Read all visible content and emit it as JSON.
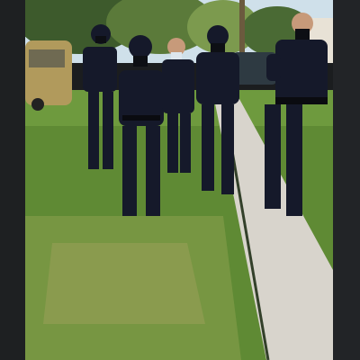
{
  "image": {
    "description_free": true,
    "colors": {
      "sky": "#cfe0ea",
      "trees_dark": "#3d5a2c",
      "trees_light": "#7c9a4e",
      "lawn": "#5f8a34",
      "lawn_shade": "#4d6f2a",
      "sidewalk": "#d8d4cc",
      "uniform": "#15192a",
      "mask": "#0d0f14",
      "skin": "#c79a7a",
      "van": "#b19a5c",
      "pillarbox": "#1e2022"
    }
  }
}
